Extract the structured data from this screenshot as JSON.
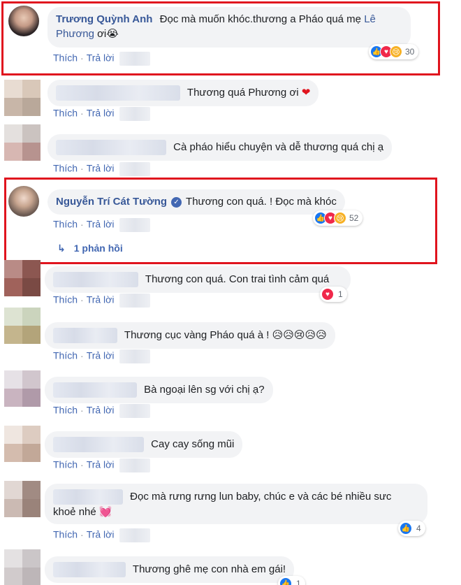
{
  "actions": {
    "like": "Thích",
    "reply": "Trả lời",
    "separator": "·"
  },
  "comments": [
    {
      "author": "Trương Quỳnh Anh",
      "text": "Đọc mà muốn khóc.thương a Pháo quá mẹ",
      "tag": "Lê Phương",
      "text_after": "ơi",
      "emoji": "😭",
      "reaction_count": "30"
    },
    {
      "text": "Thương quá Phương ơi",
      "emoji": "❤"
    },
    {
      "text": "Cà pháo hiểu chuyện và dễ thương quá chị ạ"
    },
    {
      "author": "Nguyễn Trí Cát Tường",
      "verified": "✓",
      "text": "Thương con quá. ! Đọc mà khóc",
      "reaction_count": "52",
      "replies": "1 phản hồi",
      "reply_arrow": "↳"
    },
    {
      "text": "Thương con quá. Con trai tình cảm quá",
      "reaction_count": "1"
    },
    {
      "text": "Thương cục vàng Pháo quá à !",
      "emoji": "😥😥😢😥😥"
    },
    {
      "text": "Bà ngoại lên sg với chị ạ?"
    },
    {
      "text": "Cay cay sống mũi"
    },
    {
      "text_line1": "Đọc mà rưng rưng lun baby, chúc e và các bé nhiều sưc",
      "text_line2": "khoẻ nhé",
      "emoji": "💓",
      "reaction_count": "4"
    },
    {
      "text": "Thương ghê mẹ con nhà em gái!",
      "reaction_count": "1"
    }
  ],
  "icons": {
    "like": "👍",
    "love": "♥",
    "sad": "😢"
  },
  "colors": {
    "highlight": "#e0141e",
    "link": "#385898",
    "bubble": "#f2f3f5"
  }
}
